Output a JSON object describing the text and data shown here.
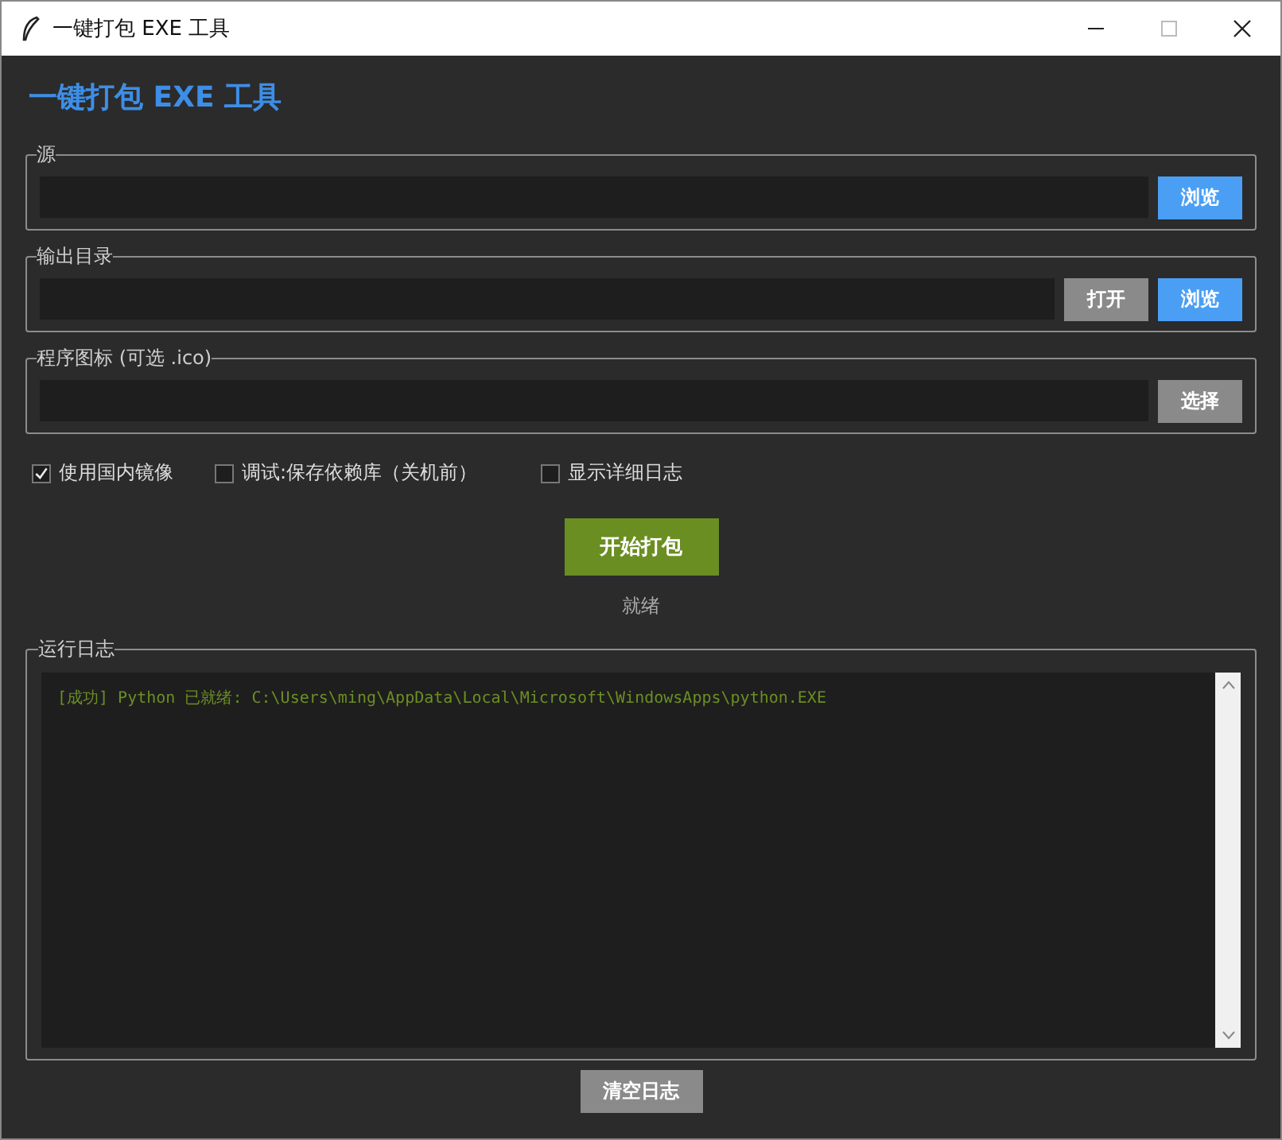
{
  "window": {
    "title": "一键打包 EXE 工具"
  },
  "heading": "一键打包 EXE 工具",
  "groups": [
    {
      "label": "源",
      "buttons": [
        {
          "label": "浏览",
          "kind": "primary"
        }
      ]
    },
    {
      "label": "输出目录",
      "buttons": [
        {
          "label": "打开",
          "kind": "secondary"
        },
        {
          "label": "浏览",
          "kind": "primary"
        }
      ]
    },
    {
      "label": "程序图标 (可选 .ico)",
      "buttons": [
        {
          "label": "选择",
          "kind": "secondary"
        }
      ]
    }
  ],
  "options": [
    {
      "label": "使用国内镜像",
      "checked": true
    },
    {
      "label": "调试:保存依赖库（关机前）",
      "checked": false
    },
    {
      "label": "显示详细日志",
      "checked": false
    }
  ],
  "start_button": "开始打包",
  "status": "就绪",
  "log": {
    "label": "运行日志",
    "lines": [
      "[成功] Python 已就绪: C:\\Users\\ming\\AppData\\Local\\Microsoft\\WindowsApps\\python.EXE"
    ]
  },
  "clear_button": "清空日志"
}
